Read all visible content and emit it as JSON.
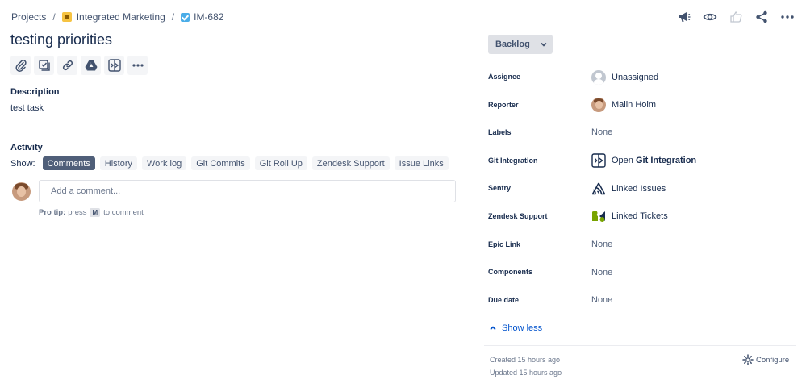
{
  "breadcrumb": {
    "projects": "Projects",
    "project": "Integrated Marketing",
    "issue_key": "IM-682",
    "separator": "/"
  },
  "issue": {
    "title": "testing priorities"
  },
  "toolbar": {
    "icons": [
      "paperclip-icon",
      "subtask-icon",
      "link-icon",
      "google-drive-icon",
      "git-integration-icon",
      "more-icon"
    ]
  },
  "description": {
    "heading": "Description",
    "text": "test task"
  },
  "activity": {
    "heading": "Activity",
    "show_label": "Show:",
    "filters": [
      "Comments",
      "History",
      "Work log",
      "Git Commits",
      "Git Roll Up",
      "Zendesk Support",
      "Issue Links"
    ],
    "active_filter": "Comments",
    "comment_placeholder": "Add a comment...",
    "protip_label": "Pro tip:",
    "protip_pre": "press",
    "protip_key": "M",
    "protip_post": "to comment"
  },
  "status": {
    "label": "Backlog"
  },
  "fields": {
    "assignee": {
      "label": "Assignee",
      "value": "Unassigned"
    },
    "reporter": {
      "label": "Reporter",
      "value": "Malin Holm"
    },
    "labels": {
      "label": "Labels",
      "value": "None"
    },
    "git_integration": {
      "label": "Git Integration",
      "value_pre": "Open",
      "value_bold": "Git Integration"
    },
    "sentry": {
      "label": "Sentry",
      "value": "Linked Issues"
    },
    "zendesk": {
      "label": "Zendesk Support",
      "value": "Linked Tickets"
    },
    "epic_link": {
      "label": "Epic Link",
      "value": "None"
    },
    "components": {
      "label": "Components",
      "value": "None"
    },
    "due_date": {
      "label": "Due date",
      "value": "None"
    }
  },
  "show_less": "Show less",
  "meta": {
    "created": "Created 15 hours ago",
    "updated": "Updated 15 hours ago",
    "configure": "Configure"
  },
  "colors": {
    "link": "#0052cc",
    "active_filter_bg": "#505f79",
    "text": "#172b4d",
    "zendesk": "#78a300"
  }
}
